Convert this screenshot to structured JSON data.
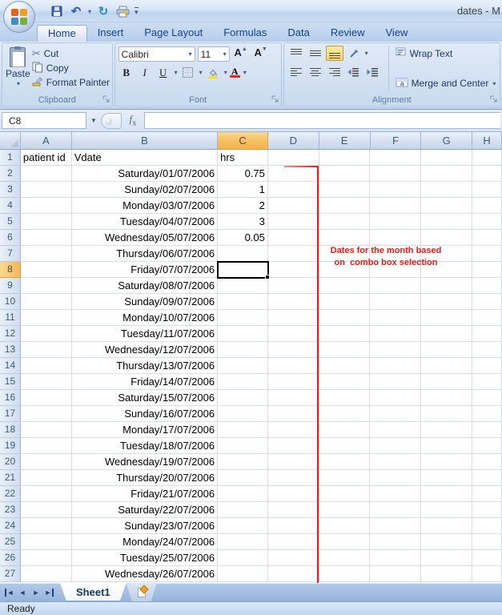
{
  "window": {
    "title": "dates - M"
  },
  "qat": {
    "buttons": [
      "save",
      "undo",
      "undo-dropdown",
      "redo",
      "quick-print",
      "customize-quick-access-toolbar"
    ]
  },
  "ribbon": {
    "tabs": [
      {
        "label": "Home",
        "active": true
      },
      {
        "label": "Insert",
        "active": false
      },
      {
        "label": "Page Layout",
        "active": false
      },
      {
        "label": "Formulas",
        "active": false
      },
      {
        "label": "Data",
        "active": false
      },
      {
        "label": "Review",
        "active": false
      },
      {
        "label": "View",
        "active": false
      }
    ],
    "groups": {
      "clipboard": {
        "label": "Clipboard",
        "paste_label": "Paste",
        "cut_label": "Cut",
        "copy_label": "Copy",
        "format_painter_label": "Format Painter"
      },
      "font": {
        "label": "Font",
        "font_name": "Calibri",
        "font_size": "11"
      },
      "alignment": {
        "label": "Alignment",
        "wrap_text_label": "Wrap Text",
        "merge_center_label": "Merge and Center"
      }
    }
  },
  "formula_bar": {
    "name_box_value": "C8",
    "fx_label": "fx",
    "formula_value": ""
  },
  "grid": {
    "columns": [
      "A",
      "B",
      "C",
      "D",
      "E",
      "F",
      "G",
      "H"
    ],
    "selected_column": "C",
    "selected_row": 8,
    "selected_cell": "C8",
    "rows": [
      {
        "n": 1,
        "a": "patient id",
        "b": "Vdate",
        "c": "hrs"
      },
      {
        "n": 2,
        "b": "Saturday/01/07/2006",
        "c": "0.75"
      },
      {
        "n": 3,
        "b": "Sunday/02/07/2006",
        "c": "1"
      },
      {
        "n": 4,
        "b": "Monday/03/07/2006",
        "c": "2"
      },
      {
        "n": 5,
        "b": "Tuesday/04/07/2006",
        "c": "3"
      },
      {
        "n": 6,
        "b": "Wednesday/05/07/2006",
        "c": "0.05"
      },
      {
        "n": 7,
        "b": "Thursday/06/07/2006"
      },
      {
        "n": 8,
        "b": "Friday/07/07/2006"
      },
      {
        "n": 9,
        "b": "Saturday/08/07/2006"
      },
      {
        "n": 10,
        "b": "Sunday/09/07/2006"
      },
      {
        "n": 11,
        "b": "Monday/10/07/2006"
      },
      {
        "n": 12,
        "b": "Tuesday/11/07/2006"
      },
      {
        "n": 13,
        "b": "Wednesday/12/07/2006"
      },
      {
        "n": 14,
        "b": "Thursday/13/07/2006"
      },
      {
        "n": 15,
        "b": "Friday/14/07/2006"
      },
      {
        "n": 16,
        "b": "Saturday/15/07/2006"
      },
      {
        "n": 17,
        "b": "Sunday/16/07/2006"
      },
      {
        "n": 18,
        "b": "Monday/17/07/2006"
      },
      {
        "n": 19,
        "b": "Tuesday/18/07/2006"
      },
      {
        "n": 20,
        "b": "Wednesday/19/07/2006"
      },
      {
        "n": 21,
        "b": "Thursday/20/07/2006"
      },
      {
        "n": 22,
        "b": "Friday/21/07/2006"
      },
      {
        "n": 23,
        "b": "Saturday/22/07/2006"
      },
      {
        "n": 24,
        "b": "Sunday/23/07/2006"
      },
      {
        "n": 25,
        "b": "Monday/24/07/2006"
      },
      {
        "n": 26,
        "b": "Tuesday/25/07/2006"
      },
      {
        "n": 27,
        "b": "Wednesday/26/07/2006"
      }
    ]
  },
  "annotation": {
    "line1": "Dates for the month based",
    "line2": "on  combo box selection",
    "color": "#ed1c16"
  },
  "sheet_bar": {
    "sheet_tabs": [
      {
        "label": "Sheet1",
        "active": true
      }
    ]
  },
  "status_bar": {
    "ready_label": "Ready"
  },
  "colors": {
    "selection_orange": "#f6bd5e",
    "grid_line": "#d5dce8",
    "red_annotation": "#ed1c16",
    "tab_text": "#15428b"
  }
}
